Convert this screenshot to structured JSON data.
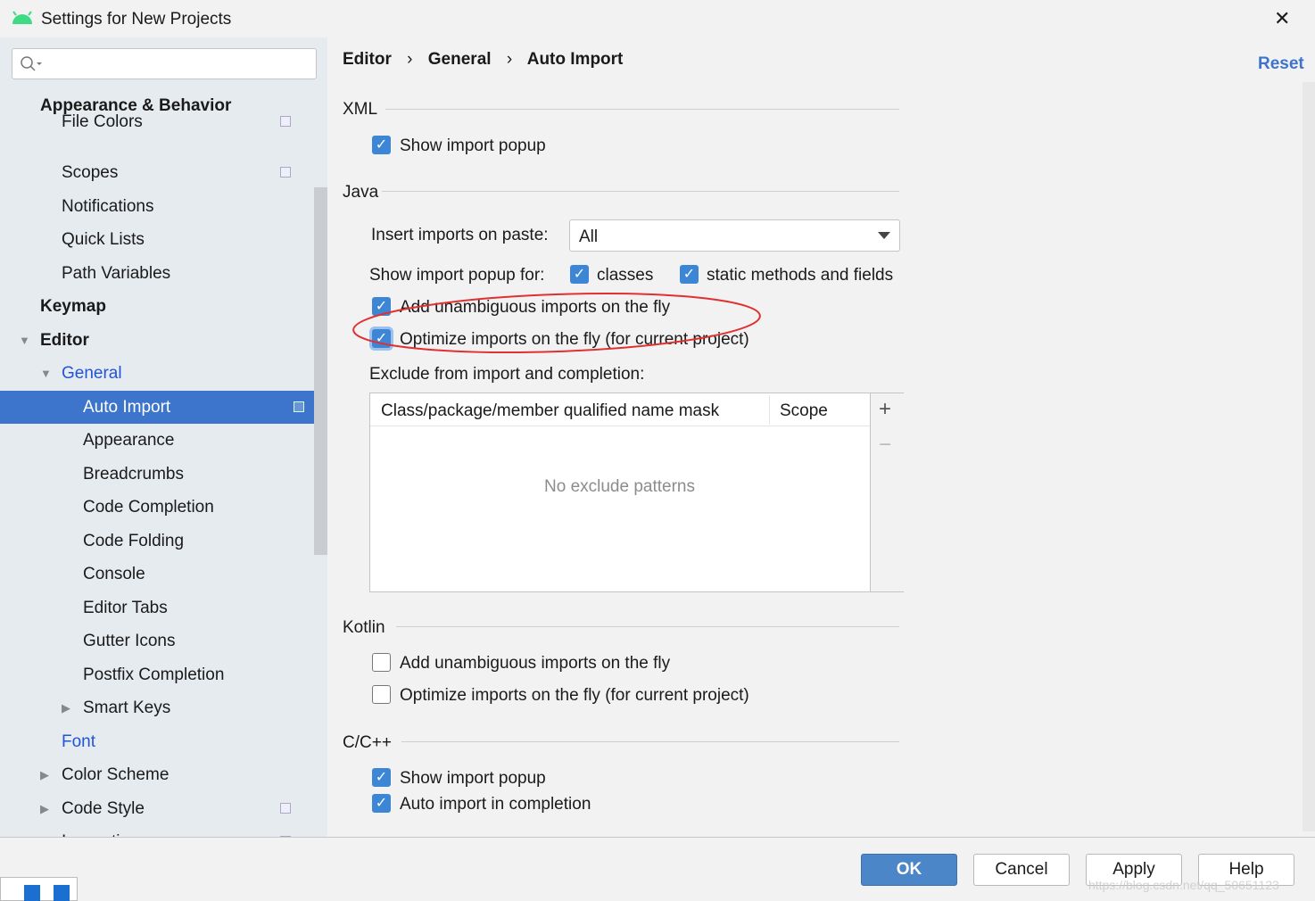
{
  "window": {
    "title": "Settings for New Projects",
    "close": "✕"
  },
  "search": {
    "placeholder": ""
  },
  "sidebar": {
    "items": [
      {
        "label": "Appearance & Behavior",
        "level": 0,
        "bold": true
      },
      {
        "label": "File Colors",
        "level": 1,
        "copy": true
      },
      {
        "label": "Scopes",
        "level": 1,
        "copy": true
      },
      {
        "label": "Notifications",
        "level": 1
      },
      {
        "label": "Quick Lists",
        "level": 1
      },
      {
        "label": "Path Variables",
        "level": 1
      },
      {
        "label": "Keymap",
        "level": 0,
        "bold": true
      },
      {
        "label": "Editor",
        "level": 0,
        "bold": true,
        "expanded": true
      },
      {
        "label": "General",
        "level": 1,
        "blue": true,
        "expanded": true
      },
      {
        "label": "Auto Import",
        "level": 2,
        "selected": true,
        "copy": true
      },
      {
        "label": "Appearance",
        "level": 2
      },
      {
        "label": "Breadcrumbs",
        "level": 2
      },
      {
        "label": "Code Completion",
        "level": 2
      },
      {
        "label": "Code Folding",
        "level": 2
      },
      {
        "label": "Console",
        "level": 2
      },
      {
        "label": "Editor Tabs",
        "level": 2
      },
      {
        "label": "Gutter Icons",
        "level": 2
      },
      {
        "label": "Postfix Completion",
        "level": 2
      },
      {
        "label": "Smart Keys",
        "level": 2,
        "collapsed": true
      },
      {
        "label": "Font",
        "level": 1,
        "blue": true
      },
      {
        "label": "Color Scheme",
        "level": 1,
        "collapsed": true
      },
      {
        "label": "Code Style",
        "level": 1,
        "collapsed": true,
        "copy": true
      },
      {
        "label": "Inspections",
        "level": 1,
        "copy": true
      }
    ]
  },
  "breadcrumb": [
    "Editor",
    "General",
    "Auto Import"
  ],
  "reset": "Reset",
  "xml": {
    "title": "XML",
    "show_popup": "Show import popup",
    "show_popup_checked": true
  },
  "java": {
    "title": "Java",
    "insert_label": "Insert imports on paste:",
    "insert_value": "All",
    "popup_for": "Show import popup for:",
    "classes": "classes",
    "static": "static methods and fields",
    "add_unambiguous": "Add unambiguous imports on the fly",
    "optimize": "Optimize imports on the fly (for current project)",
    "exclude_label": "Exclude from import and completion:",
    "col_mask": "Class/package/member qualified name mask",
    "col_scope": "Scope",
    "empty": "No exclude patterns",
    "add": "+",
    "remove": "−"
  },
  "kotlin": {
    "title": "Kotlin",
    "add_unambiguous": "Add unambiguous imports on the fly",
    "optimize": "Optimize imports on the fly (for current project)"
  },
  "cpp": {
    "title": "C/C++",
    "show_popup": "Show import popup",
    "auto_import": "Auto import in completion"
  },
  "footer": {
    "ok": "OK",
    "cancel": "Cancel",
    "apply": "Apply",
    "help": "Help",
    "watermark": "https://blog.csdn.net/qq_50651123"
  },
  "colors": {
    "accent": "#3d74cc",
    "checkbox": "#3d86d6",
    "annotation": "#e03030"
  }
}
